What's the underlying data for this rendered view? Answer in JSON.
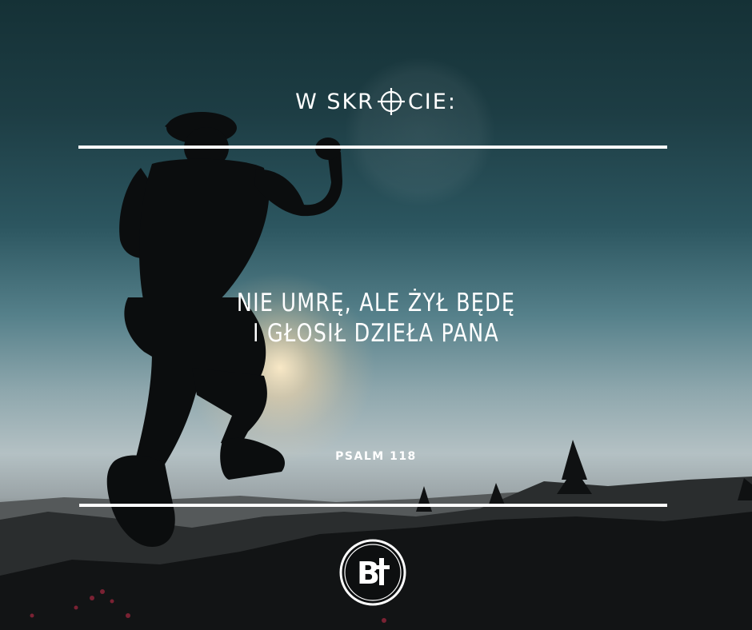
{
  "header": {
    "title_left": "W SKR",
    "title_right": "CIE:",
    "title_icon": "crosshair-icon"
  },
  "quote": {
    "line1": "NIE UMRĘ, ALE ŻYŁ BĘDĘ",
    "line2": "I GŁOSIŁ DZIEŁA PANA"
  },
  "reference": "PSALM 118",
  "logo": {
    "text": "B",
    "icon": "cross-icon"
  },
  "colors": {
    "text": "#ffffff",
    "sky_top": "#153136",
    "sky_horizon": "#b4c1c4",
    "sun_glow": "#ffecc8",
    "silhouette": "#0b0d0e"
  }
}
